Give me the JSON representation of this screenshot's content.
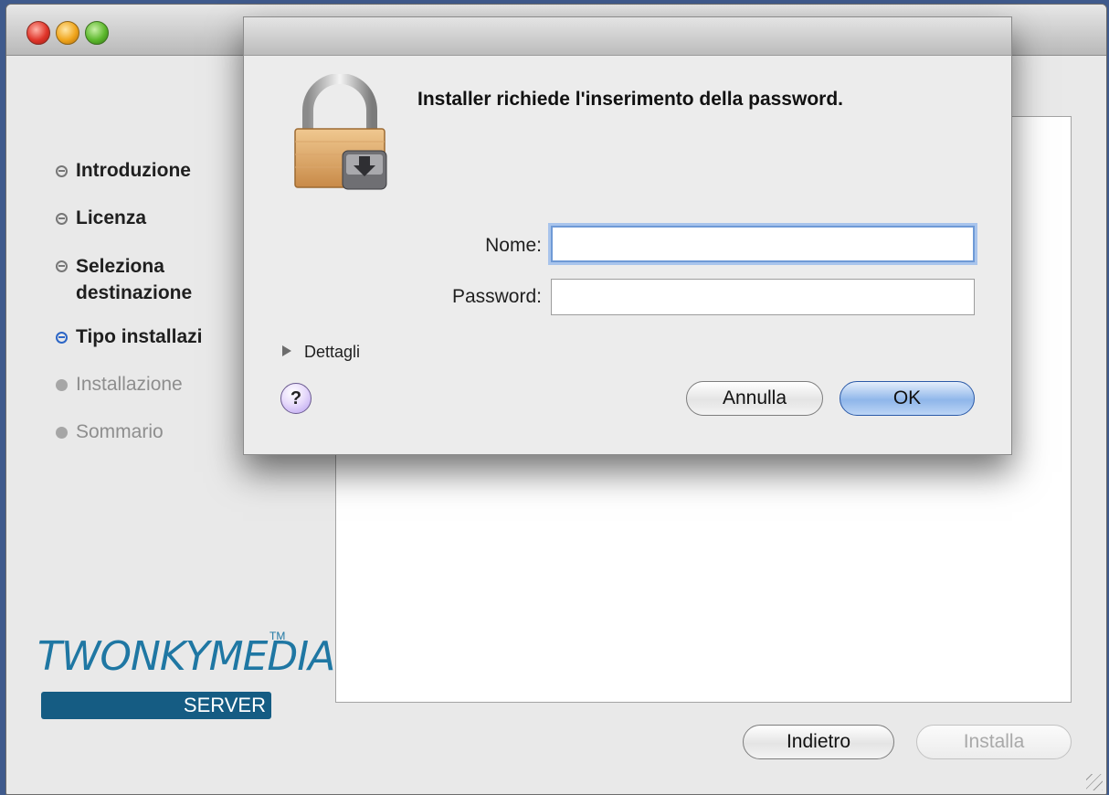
{
  "window": {
    "controls": [
      "close",
      "minimize",
      "zoom"
    ]
  },
  "sidebar": {
    "steps": [
      {
        "label": "Introduzione",
        "state": "done"
      },
      {
        "label": "Licenza",
        "state": "done"
      },
      {
        "label": "Seleziona destinazione",
        "state": "done"
      },
      {
        "label": "Tipo installazi",
        "state": "current"
      },
      {
        "label": "Installazione",
        "state": "future"
      },
      {
        "label": "Sommario",
        "state": "future"
      }
    ]
  },
  "logo": {
    "brand": "TWONKYMEDIA",
    "tm": "TM",
    "sub": "SERVER"
  },
  "footer": {
    "back_label": "Indietro",
    "install_label": "Installa"
  },
  "dialog": {
    "message": "Installer richiede l'inserimento della password.",
    "name_label": "Nome:",
    "name_value": "",
    "password_label": "Password:",
    "password_value": "",
    "details_label": "Dettagli",
    "help_label": "?",
    "cancel_label": "Annulla",
    "ok_label": "OK"
  },
  "colors": {
    "accent": "#2d66c6",
    "focus_ring": "#a8c4ec",
    "logo_blue": "#1f77a3",
    "desktop": "#3f5a8c"
  },
  "icons": [
    "lock-icon",
    "drive-icon",
    "help-icon",
    "disclosure-triangle-icon",
    "resize-grip-icon"
  ]
}
